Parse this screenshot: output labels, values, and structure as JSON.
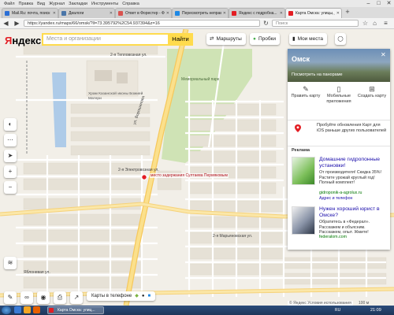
{
  "browser": {
    "menu": [
      "Файл",
      "Правка",
      "Вид",
      "Журнал",
      "Закладки",
      "Инструменты",
      "Справка"
    ],
    "tabs": [
      {
        "label": "Mail.Ru: почта, поиск в инт...",
        "color": "#2b6fd6"
      },
      {
        "label": "Диалоги",
        "color": "#4a76a8"
      },
      {
        "label": "Ответ в Форестер - Форум...",
        "color": "#d9534f"
      },
      {
        "label": "Пересмотреть неправосуд...",
        "color": "#1e88e5"
      },
      {
        "label": "Яндекс с подробна...",
        "color": "#e31e24"
      },
      {
        "label": "Карта Омска: улицы, дома...",
        "color": "#e31e24"
      }
    ],
    "url": "https://yandex.ru/maps/66/omsk/?ll=73.395792%2C54.937394&z=16",
    "search_placeholder": "Поиск"
  },
  "yandex": {
    "logo_first": "Я",
    "logo_rest": "ндекс",
    "search_placeholder": "Места и организации",
    "find_label": "Найти",
    "routes_label": "Маршруты",
    "traffic_label": "Пробки",
    "myplaces_label": "Мои места"
  },
  "panel": {
    "city": "Омск",
    "pano_label": "Посмотреть на панораме",
    "actions": [
      "Править карту",
      "Мобильные приложения",
      "Создать карту"
    ],
    "update_text": "Пробуйте обновления Карт для iOS раньше других пользователей",
    "ads_label": "Реклама",
    "ads": [
      {
        "title": "Домашние гидропонные установки!",
        "text": "От производителя! Скидка 35%! Растите урожай круглый год! Полный комплект!",
        "link": "gidroponik-a-agrolux.ru",
        "sub": "Адрес и телефон"
      },
      {
        "title": "Нужен хороший юрист в Омске?",
        "text": "Обратитесь в «Федерал». Расскажем и объясним. Расскажем, опыт. Жмите!",
        "link": "federalom.com",
        "sub": ""
      }
    ]
  },
  "map": {
    "marker_label": "место задержания Султаева Пермяковым",
    "labels": {
      "cemetery": "Мемориальный парк",
      "church": "Храм Казанской иконы Божией Матери",
      "teplovaya": "2-я Тепловозная ул.",
      "lomanaya": "Ломоносовская ул.",
      "marynovskaya": "2-я Марьяновская ул.",
      "elektrovoznaya": "2-я Электровозная ул.",
      "yablonevaya": "Яблоневая ул.",
      "voroshilova": "ул. Ворошилова"
    }
  },
  "bottom": {
    "phone_label": "Карты в телефоне",
    "copyright": "© Яндекс Условия использования",
    "scale": "100 м"
  },
  "taskbar": {
    "task_label": "Карта Омска: улиц...",
    "tray": "RU",
    "clock": "21:09"
  }
}
